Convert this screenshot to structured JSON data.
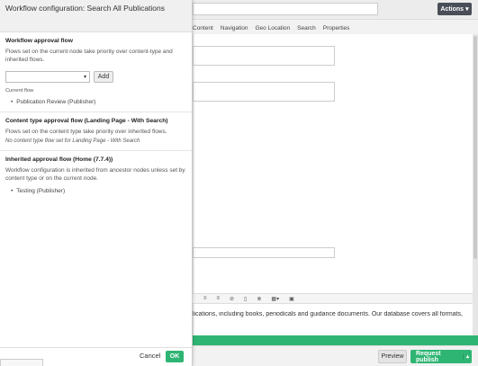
{
  "dialog": {
    "title": "Workflow configuration: Search All Publications",
    "workflow_flow": {
      "heading": "Workflow approval flow",
      "description": "Flows set on the current node take priority over content-type and inherited flows.",
      "select_value": "",
      "add_label": "Add",
      "current_flow_label": "Current flow",
      "current_flow_item": "Publication Review (Publisher)"
    },
    "content_type_flow": {
      "heading": "Content type approval flow (Landing Page - With Search)",
      "description": "Flows set on the content type take priority over inherited flows.",
      "note": "No content type flow set for Landing Page - With Search"
    },
    "inherited_flow": {
      "heading": "Inherited approval flow (Home (7.7.4))",
      "description": "Workflow configuration is inherited from ancestor nodes unless set by content type or on the current node.",
      "item": "Testing (Publisher)"
    },
    "cancel_label": "Cancel",
    "ok_label": "OK"
  },
  "background": {
    "actions_label": "Actions",
    "tabs": [
      "Content",
      "Navigation",
      "Geo Location",
      "Search",
      "Properties"
    ],
    "editor_text": "lications, including books, periodicals and guidance documents. Our database covers all formats,",
    "preview_label": "Preview",
    "publish_label": "Request publish"
  },
  "colors": {
    "accent_green": "#2fb573",
    "actions_dark": "#4a4f57"
  }
}
